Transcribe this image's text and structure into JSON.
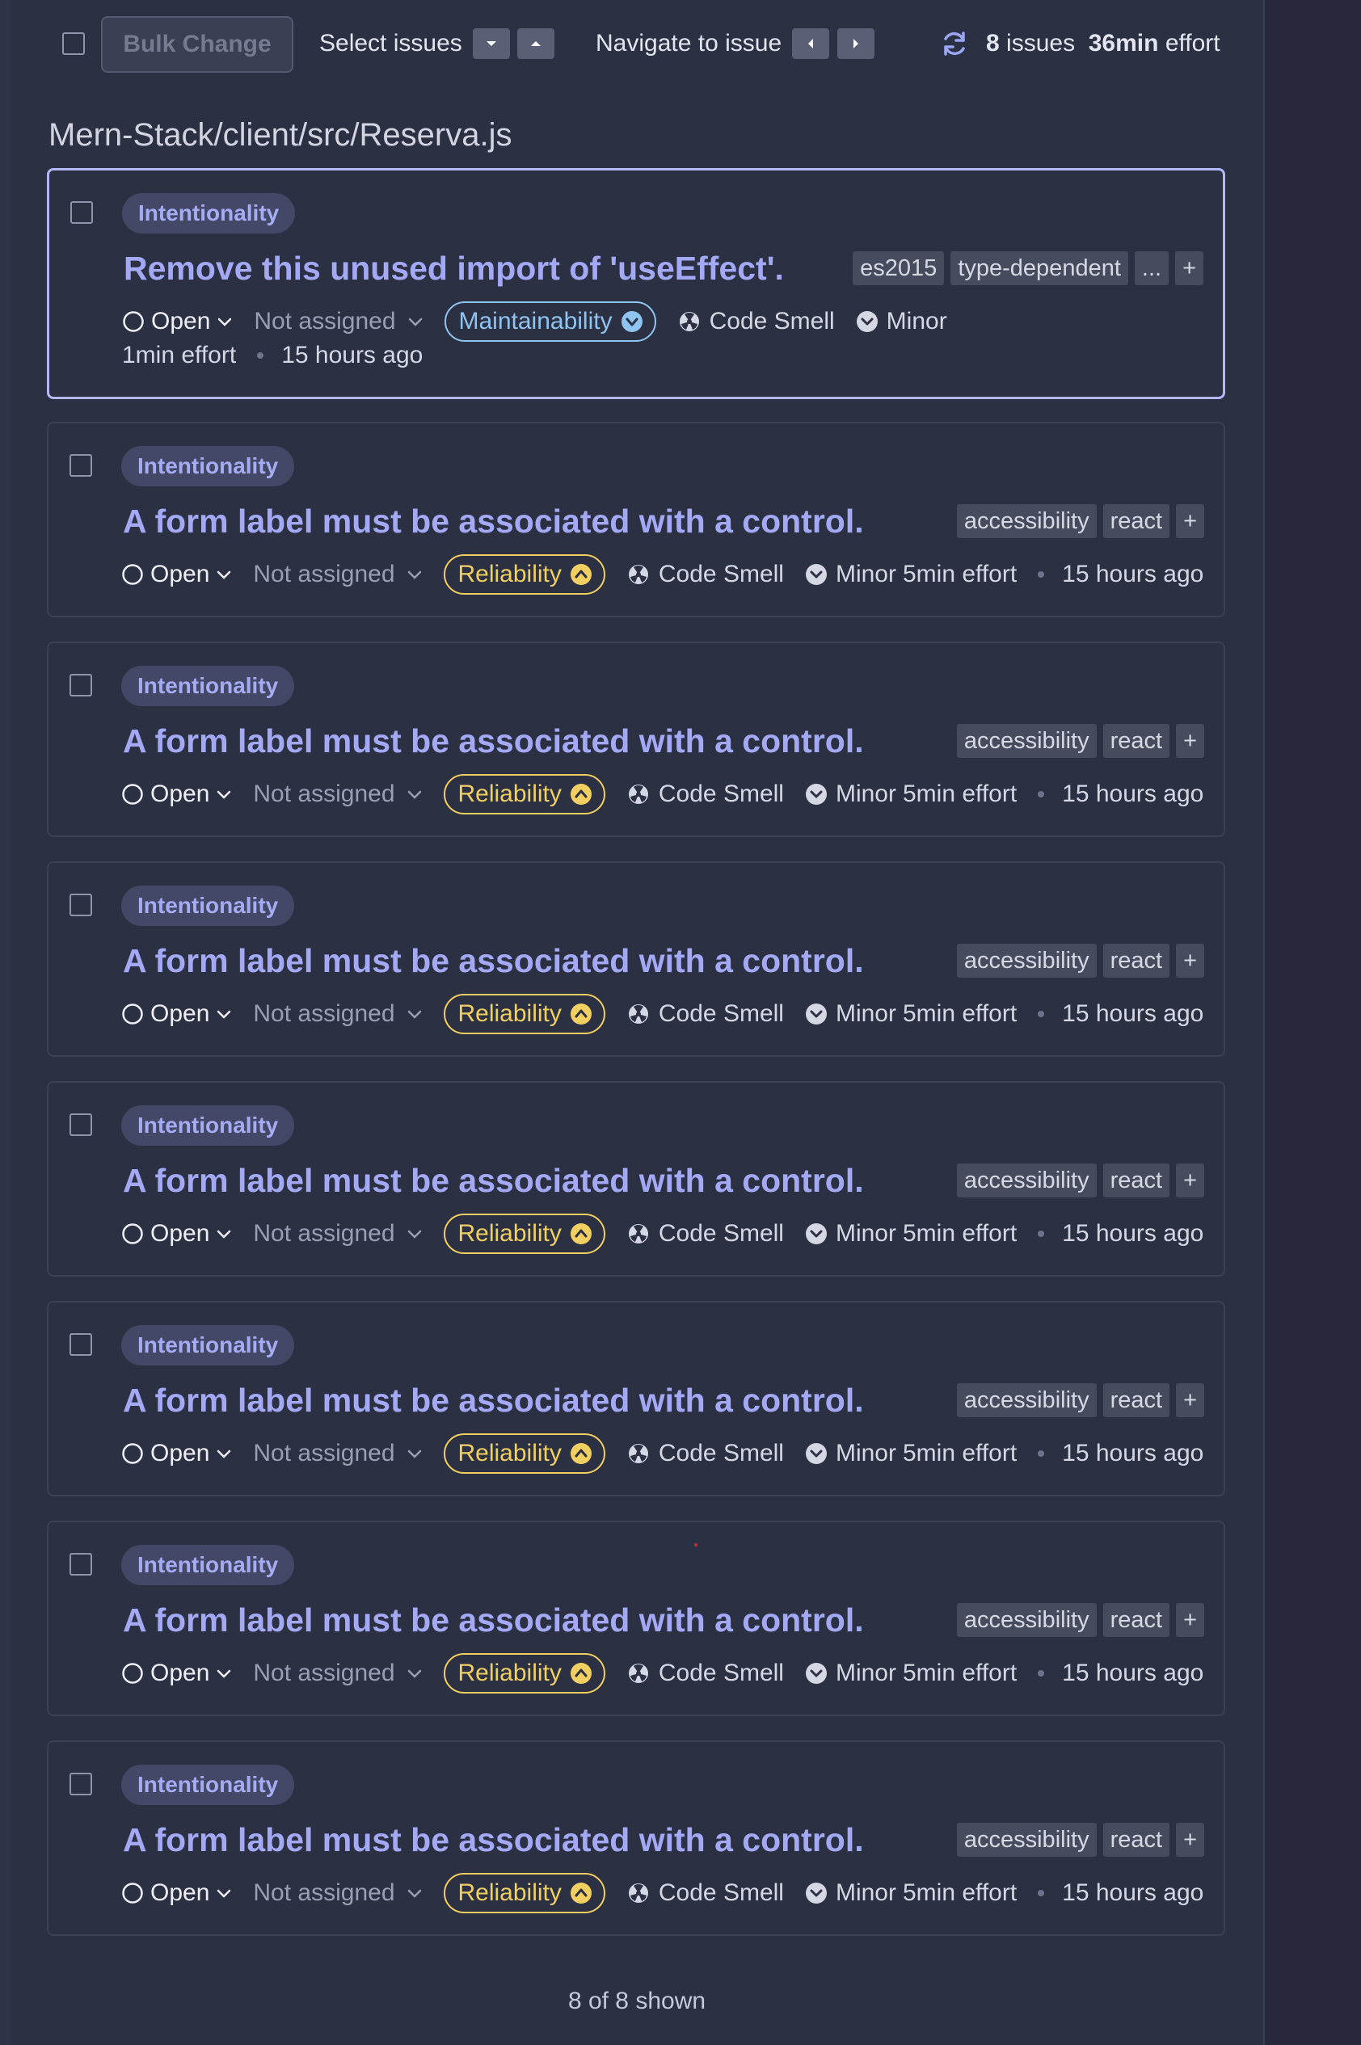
{
  "toolbar": {
    "bulk_change": "Bulk Change",
    "select_issues": "Select issues",
    "navigate_to_issue": "Navigate to issue",
    "issues_count": "8",
    "issues_word": "issues",
    "effort_value": "36min",
    "effort_word": "effort"
  },
  "file_path": "Mern-Stack/client/src/Reserva.js",
  "issues": [
    {
      "badge": "Intentionality",
      "title": "Remove this unused import of 'useEffect'.",
      "tags": [
        "es2015",
        "type-dependent",
        "..."
      ],
      "add": "+",
      "status": "Open",
      "assignee": "Not assigned",
      "quality": "Maintainability",
      "type": "Code Smell",
      "severity": "Minor",
      "effort": "1min effort",
      "age": "15 hours ago"
    },
    {
      "badge": "Intentionality",
      "title": "A form label must be associated with a control.",
      "tags": [
        "accessibility",
        "react"
      ],
      "add": "+",
      "status": "Open",
      "assignee": "Not assigned",
      "quality": "Reliability",
      "type": "Code Smell",
      "severity": "Minor",
      "effort": "5min effort",
      "age": "15 hours ago"
    },
    {
      "badge": "Intentionality",
      "title": "A form label must be associated with a control.",
      "tags": [
        "accessibility",
        "react"
      ],
      "add": "+",
      "status": "Open",
      "assignee": "Not assigned",
      "quality": "Reliability",
      "type": "Code Smell",
      "severity": "Minor",
      "effort": "5min effort",
      "age": "15 hours ago"
    },
    {
      "badge": "Intentionality",
      "title": "A form label must be associated with a control.",
      "tags": [
        "accessibility",
        "react"
      ],
      "add": "+",
      "status": "Open",
      "assignee": "Not assigned",
      "quality": "Reliability",
      "type": "Code Smell",
      "severity": "Minor",
      "effort": "5min effort",
      "age": "15 hours ago"
    },
    {
      "badge": "Intentionality",
      "title": "A form label must be associated with a control.",
      "tags": [
        "accessibility",
        "react"
      ],
      "add": "+",
      "status": "Open",
      "assignee": "Not assigned",
      "quality": "Reliability",
      "type": "Code Smell",
      "severity": "Minor",
      "effort": "5min effort",
      "age": "15 hours ago"
    },
    {
      "badge": "Intentionality",
      "title": "A form label must be associated with a control.",
      "tags": [
        "accessibility",
        "react"
      ],
      "add": "+",
      "status": "Open",
      "assignee": "Not assigned",
      "quality": "Reliability",
      "type": "Code Smell",
      "severity": "Minor",
      "effort": "5min effort",
      "age": "15 hours ago"
    },
    {
      "badge": "Intentionality",
      "title": "A form label must be associated with a control.",
      "tags": [
        "accessibility",
        "react"
      ],
      "add": "+",
      "status": "Open",
      "assignee": "Not assigned",
      "quality": "Reliability",
      "type": "Code Smell",
      "severity": "Minor",
      "effort": "5min effort",
      "age": "15 hours ago"
    },
    {
      "badge": "Intentionality",
      "title": "A form label must be associated with a control.",
      "tags": [
        "accessibility",
        "react"
      ],
      "add": "+",
      "status": "Open",
      "assignee": "Not assigned",
      "quality": "Reliability",
      "type": "Code Smell",
      "severity": "Minor",
      "effort": "5min effort",
      "age": "15 hours ago"
    }
  ],
  "footer": "8 of 8 shown",
  "colors": {
    "accent": "#a3a9f5",
    "maintainability": "#8fc4f0",
    "reliability": "#f1cf61",
    "background": "#2b2f41"
  }
}
